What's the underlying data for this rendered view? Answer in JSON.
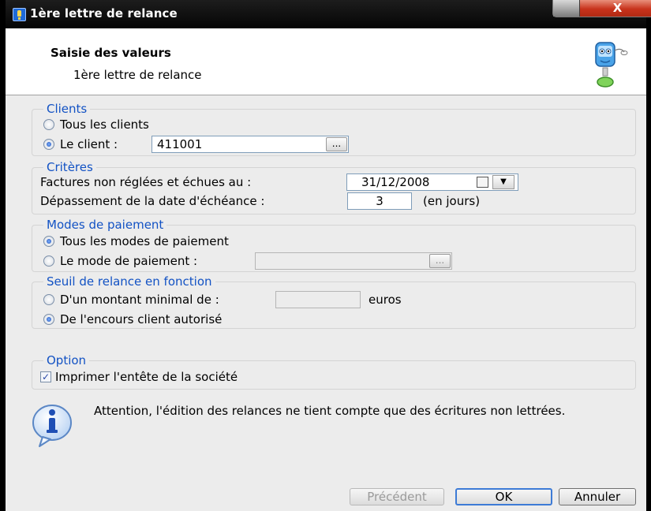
{
  "window": {
    "title": "1ère lettre de relance",
    "close_symbol": "X",
    "icon": "app-help-icon"
  },
  "header": {
    "title": "Saisie des valeurs",
    "subtitle": "1ère lettre de relance",
    "mascot_icon": "assistant-mascot-icon"
  },
  "clients": {
    "legend": "Clients",
    "option_all": "Tous les clients",
    "option_one": "Le client :",
    "selected": "option_one",
    "client_value": "411001",
    "browse_label": "..."
  },
  "criteres": {
    "legend": "Critères",
    "date_label": "Factures non réglées et échues au :",
    "date_value": "31/12/2008",
    "overdue_label": "Dépassement de la date d'échéance :",
    "overdue_value": "3",
    "overdue_unit": "(en jours)"
  },
  "modes": {
    "legend": "Modes de paiement",
    "option_all": "Tous les modes de paiement",
    "option_one": "Le mode de paiement :",
    "selected": "option_all",
    "mode_value": "",
    "browse_label": "..."
  },
  "seuil": {
    "legend": "Seuil de relance en fonction",
    "option_amount": "D'un montant minimal de :",
    "amount_value": "",
    "amount_unit": "euros",
    "option_outstanding": "De l'encours client autorisé",
    "selected": "option_outstanding"
  },
  "option": {
    "legend": "Option",
    "print_header_label": "Imprimer l'entête de la société",
    "print_header_checked": true,
    "check_mark": "✓"
  },
  "info": {
    "icon": "info-icon",
    "message": "Attention, l'édition des relances ne tient compte que des écritures non lettrées."
  },
  "buttons": {
    "previous": "Précédent",
    "ok": "OK",
    "cancel": "Annuler"
  }
}
